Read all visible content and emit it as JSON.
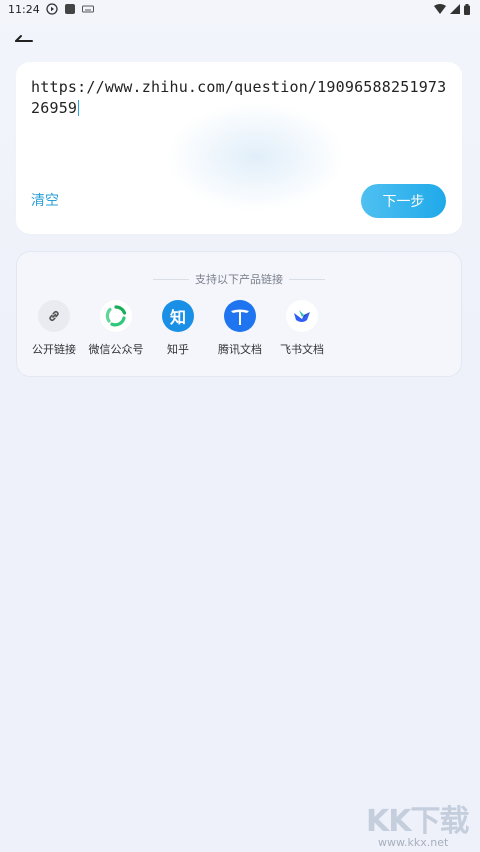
{
  "status_bar": {
    "time": "11:24",
    "icons_left": [
      "play-circle-icon",
      "app-square-icon",
      "keyboard-icon"
    ],
    "icons_right": [
      "wifi-icon",
      "signal-icon",
      "battery-icon"
    ]
  },
  "header": {
    "back_icon": "back-arrow-icon"
  },
  "input_card": {
    "url_value": "https://www.zhihu.com/question/1909658825197326959",
    "clear_label": "清空",
    "next_label": "下一步"
  },
  "support": {
    "title": "支持以下产品链接",
    "products": [
      {
        "label": "公开链接",
        "icon": "link-icon",
        "color": "#e9ebf0"
      },
      {
        "label": "微信公众号",
        "icon": "wechat-mp-icon",
        "color": "#2fb968"
      },
      {
        "label": "知乎",
        "icon": "zhihu-icon",
        "color": "#1a8fe6"
      },
      {
        "label": "腾讯文档",
        "icon": "tencent-docs-icon",
        "color": "#1f74f0"
      },
      {
        "label": "飞书文档",
        "icon": "feishu-docs-icon",
        "color": "#2f5ff5"
      }
    ]
  },
  "watermark": {
    "big": "KK下载",
    "small": "www.kkx.net"
  }
}
